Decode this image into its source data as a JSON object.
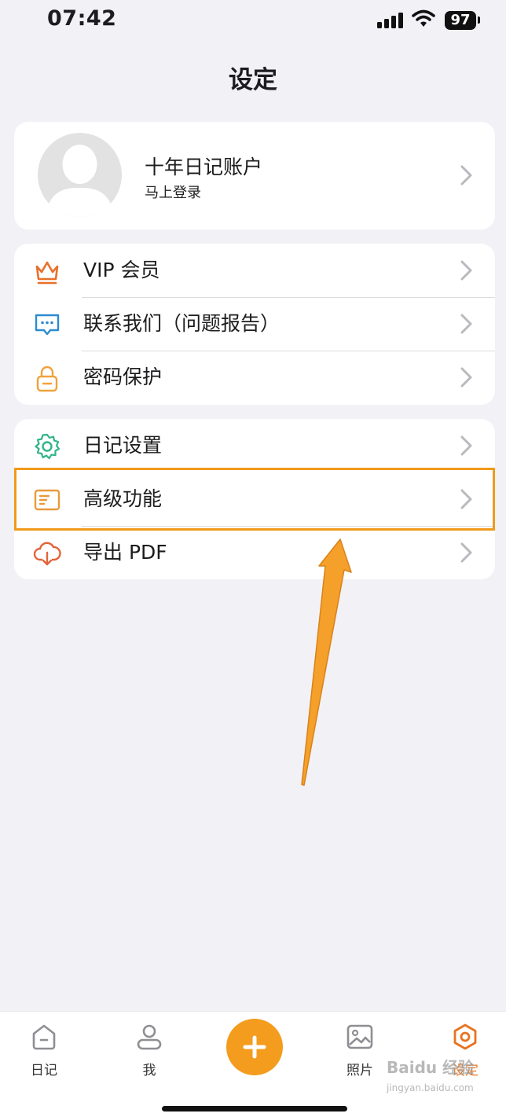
{
  "status_bar": {
    "time": "07:42",
    "battery": "97"
  },
  "page": {
    "title": "设定"
  },
  "profile": {
    "name": "十年日记账户",
    "subtitle": "马上登录"
  },
  "group1": {
    "items": [
      {
        "label": "VIP 会员",
        "icon": "crown-icon",
        "color": "#e8702a"
      },
      {
        "label": "联系我们（问题报告）",
        "icon": "chat-bubble-icon",
        "color": "#2b8bd1"
      },
      {
        "label": "密码保护",
        "icon": "lock-icon",
        "color": "#f0a23a"
      }
    ]
  },
  "group2": {
    "items": [
      {
        "label": "日记设置",
        "icon": "gear-icon",
        "color": "#2fb587"
      },
      {
        "label": "高级功能",
        "icon": "document-icon",
        "color": "#e89a3c"
      },
      {
        "label": "导出 PDF",
        "icon": "cloud-download-icon",
        "color": "#e2643a"
      }
    ]
  },
  "tab_bar": {
    "tabs": [
      {
        "label": "日记",
        "icon": "diary-icon",
        "active": false
      },
      {
        "label": "我",
        "icon": "person-icon",
        "active": false
      },
      {
        "label": "",
        "icon": "plus-icon",
        "active": false
      },
      {
        "label": "照片",
        "icon": "photo-icon",
        "active": false
      },
      {
        "label": "设定",
        "icon": "hexagon-settings-icon",
        "active": true
      }
    ]
  },
  "colors": {
    "accent": "#f39c1e",
    "active_tab": "#e8731f",
    "highlight": "#f09a1b",
    "background": "#f2f1f6"
  },
  "watermark": {
    "text": "Baidu 经验",
    "url_text": "jingyan.baidu.com"
  }
}
